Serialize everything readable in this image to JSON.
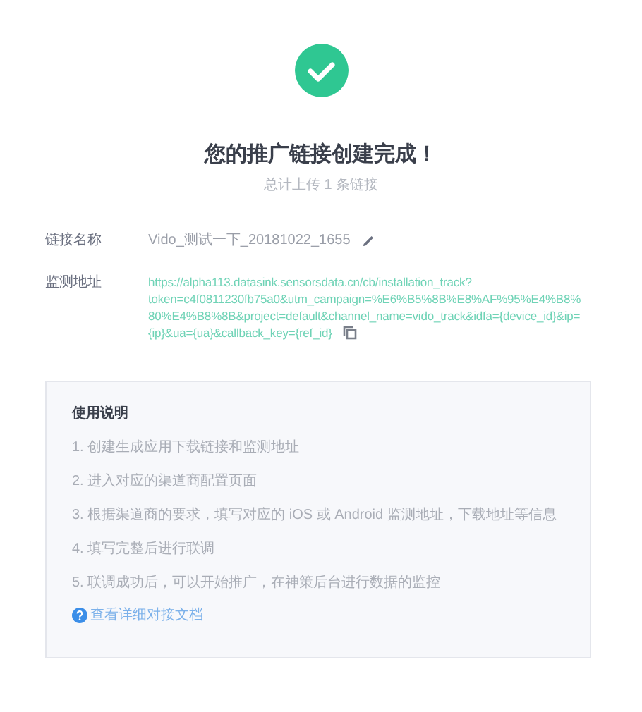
{
  "title": "您的推广链接创建完成！",
  "subtitle": "总计上传 1 条链接",
  "fields": [
    {
      "kind": "name",
      "label": "链接名称",
      "value_lines": [
        "Vido_测试一下_20181022_1655"
      ]
    },
    {
      "kind": "url",
      "label": "监测地址",
      "value_lines": [
        "https://alpha113.datasink.sensorsdata.cn/cb/installation_track?",
        "token=c4f0811230fb75a0&utm_campaign=%E6%B5%8B%E8%AF%95%E4%B8%",
        "80%E4%B8%8B&project=default&channel_name=vido_track&idfa={device_id}&ip=",
        "{ip}&ua={ua}&callback_key={ref_id}"
      ]
    }
  ],
  "instructions": {
    "title": "使用说明",
    "steps": [
      "1. 创建生成应用下载链接和监测地址",
      "2. 进入对应的渠道商配置页面",
      "3. 根据渠道商的要求，填写对应的 iOS 或 Android 监测地址，下载地址等信息",
      "4. 填写完整后进行联调",
      "5. 联调成功后，可以开始推广，在神策后台进行数据的监控"
    ],
    "link": "查看详细对接文档"
  }
}
